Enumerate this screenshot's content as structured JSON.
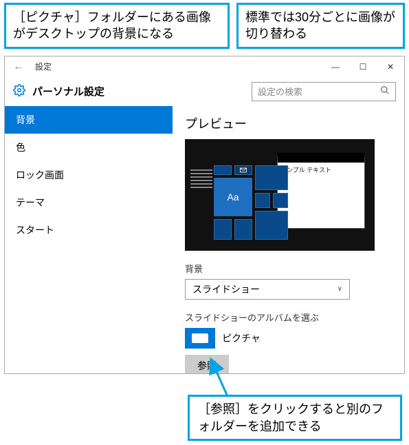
{
  "callouts": {
    "top_left": "［ピクチャ］フォルダーにある画像がデスクトップの背景になる",
    "top_right": "標準では30分ごとに画像が切り替わる",
    "bottom": "［参照］をクリックすると別のフォルダーを追加できる"
  },
  "titlebar": {
    "back_icon": "←",
    "title": "設定",
    "min_icon": "—",
    "max_icon": "☐",
    "close_icon": "✕"
  },
  "header": {
    "page_title": "パーソナル設定",
    "search_placeholder": "設定の検索",
    "search_icon": "🔍"
  },
  "sidebar": {
    "items": [
      {
        "label": "背景",
        "selected": true
      },
      {
        "label": "色",
        "selected": false
      },
      {
        "label": "ロック画面",
        "selected": false
      },
      {
        "label": "テーマ",
        "selected": false
      },
      {
        "label": "スタート",
        "selected": false
      }
    ]
  },
  "content": {
    "preview_heading": "プレビュー",
    "preview_sample_text": "サンプル テキスト",
    "preview_tile_text": "Aa",
    "background_label": "背景",
    "background_value": "スライドショー",
    "album_label": "スライドショーのアルバムを選ぶ",
    "album_name": "ピクチャ",
    "browse_button": "参照"
  },
  "icons": {
    "gear": "gear-icon",
    "chevron_down": "∨"
  }
}
